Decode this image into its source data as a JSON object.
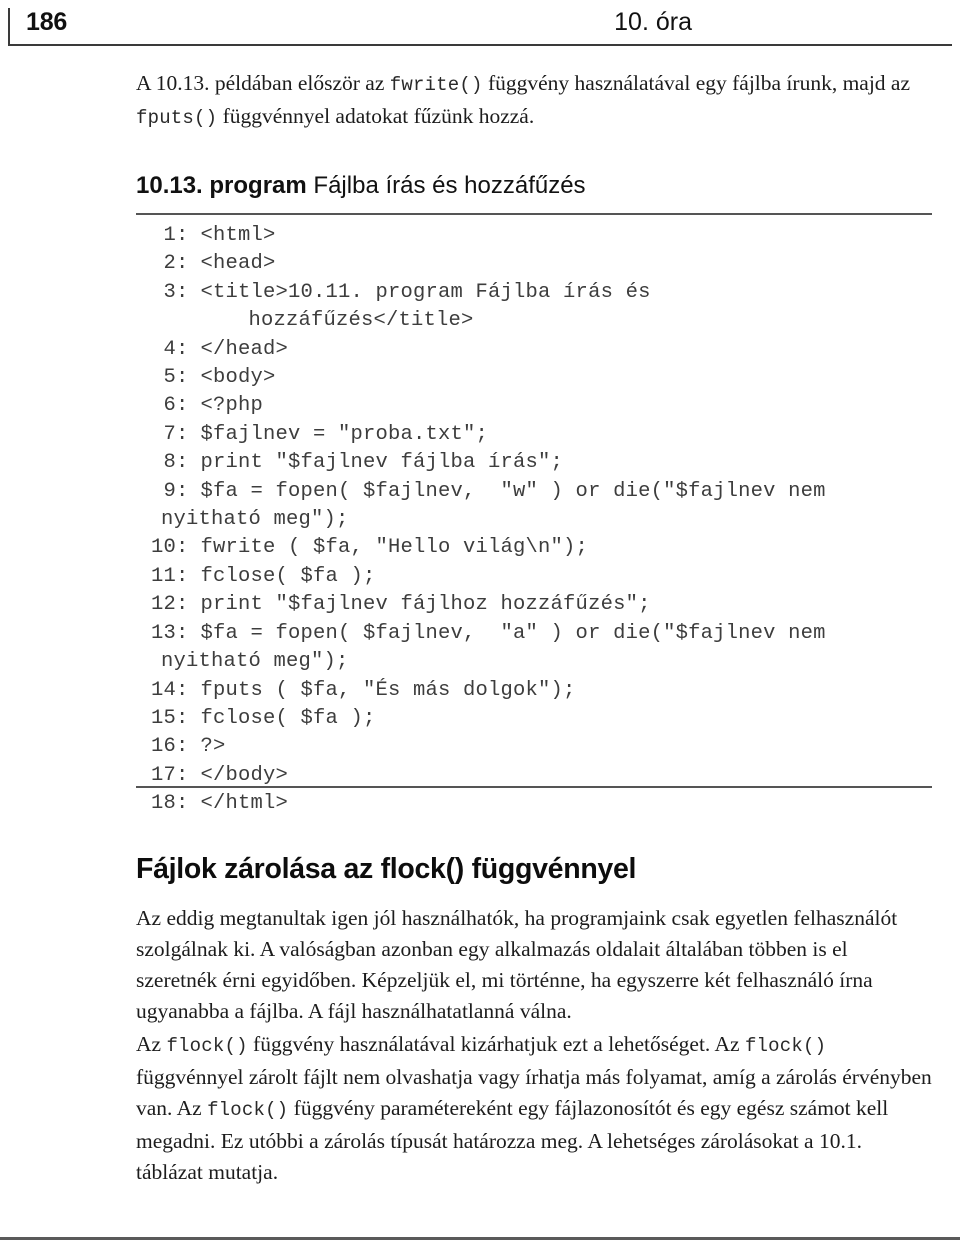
{
  "page": {
    "folio": "186",
    "running_title": "10. óra"
  },
  "intro": {
    "part1": "A 10.13. példában először az ",
    "mono1": "fwrite()",
    "part2": " függvény használatával egy fájlba írunk, majd az ",
    "mono2": "fputs()",
    "part3": " függvénnyel adatokat fűzünk hozzá."
  },
  "listing": {
    "caption_number": "10.13. program",
    "caption_title": "Fájlba írás és hozzáfűzés",
    "lines": [
      {
        "n": "1",
        "code": "<html>"
      },
      {
        "n": "2",
        "code": "<head>"
      },
      {
        "n": "3",
        "code": "<title>10.11. program Fájlba írás és",
        "cont": "         hozzáfűzés</title>"
      },
      {
        "n": "4",
        "code": "</head>"
      },
      {
        "n": "5",
        "code": "<body>"
      },
      {
        "n": "6",
        "code": "<?php"
      },
      {
        "n": "7",
        "code": "$fajlnev = \"proba.txt\";"
      },
      {
        "n": "8",
        "code": "print \"$fajlnev fájlba írás\";"
      },
      {
        "n": "9",
        "code": "$fa = fopen( $fajlnev,  \"w\" ) or die(\"$fajlnev nem",
        "cont": "  nyitható meg\");"
      },
      {
        "n": "10",
        "code": "fwrite ( $fa, \"Hello világ\\n\");"
      },
      {
        "n": "11",
        "code": "fclose( $fa );"
      },
      {
        "n": "12",
        "code": "print \"$fajlnev fájlhoz hozzáfűzés\";"
      },
      {
        "n": "13",
        "code": "$fa = fopen( $fajlnev,  \"a\" ) or die(\"$fajlnev nem",
        "cont": "  nyitható meg\");"
      },
      {
        "n": "14",
        "code": "fputs ( $fa, \"És más dolgok\");"
      },
      {
        "n": "15",
        "code": "fclose( $fa );"
      },
      {
        "n": "16",
        "code": "?>"
      },
      {
        "n": "17",
        "code": "</body>"
      },
      {
        "n": "18",
        "code": "</html>"
      }
    ]
  },
  "section": {
    "heading": "Fájlok zárolása az flock() függvénnyel",
    "para1": "Az eddig megtanultak igen jól használhatók, ha programjaink csak egyetlen felhasználót szolgálnak ki. A valóságban azonban egy alkalmazás oldalait általában többen is el szeretnék érni egyidőben. Képzeljük el, mi történne, ha egyszerre két felhasználó írna ugyanabba a fájlba. A fájl használhatatlanná válna.",
    "para2": {
      "t1": "Az ",
      "m1": "flock()",
      "t2": " függvény használatával kizárhatjuk ezt a lehetőséget. Az ",
      "m2": "flock()",
      "t3": " függvénnyel zárolt fájlt nem olvashatja vagy írhatja más folyamat, amíg a zárolás érvényben van. Az ",
      "m3": "flock()",
      "t4": " függvény paramétereként egy fájlazonosítót és egy egész számot kell megadni. Ez utóbbi a zárolás típusát határozza meg. A lehetséges zárolásokat a 10.1. táblázat mutatja."
    }
  }
}
